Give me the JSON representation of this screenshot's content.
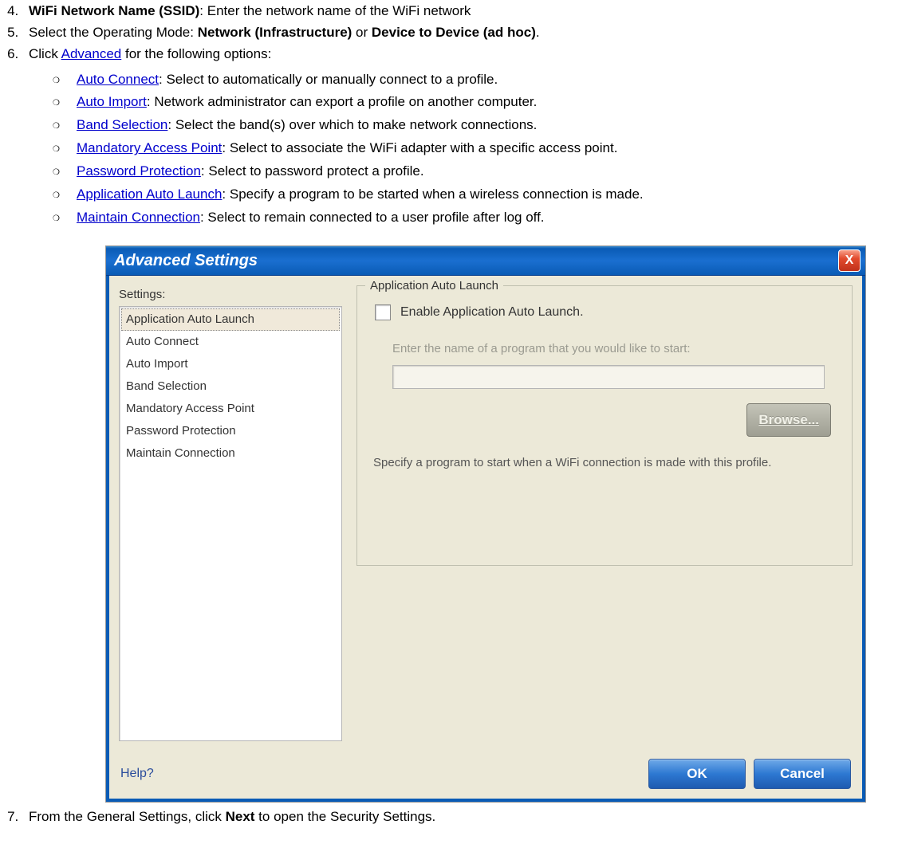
{
  "instructions": {
    "item4": {
      "bold": "WiFi Network Name (SSID)",
      "rest": ": Enter the network name of the WiFi network"
    },
    "item5": {
      "pre": "Select the Operating Mode: ",
      "b1": "Network (Infrastructure)",
      "mid": " or ",
      "b2": "Device to Device (ad hoc)",
      "post": "."
    },
    "item6": {
      "pre": "Click ",
      "link": "Advanced",
      "post": " for the following options:",
      "sub": [
        {
          "link": "Auto Connect",
          "rest": ": Select to automatically or manually connect to a profile."
        },
        {
          "link": "Auto Import",
          "rest": ": Network administrator can export a profile on another computer."
        },
        {
          "link": "Band Selection",
          "rest": ": Select the band(s) over which to make network connections."
        },
        {
          "link": "Mandatory Access Point",
          "rest": ": Select to associate the WiFi adapter with a specific access point."
        },
        {
          "link": "Password Protection",
          "rest": ": Select to password protect a profile."
        },
        {
          "link": "Application Auto Launch",
          "rest": ": Specify a program to be started when a wireless connection is made."
        },
        {
          "link": "Maintain Connection",
          "rest": ": Select to remain connected to a user profile after log off."
        }
      ]
    },
    "item7": {
      "pre": "From the General Settings, click ",
      "b1": "Next",
      "post": " to open the Security Settings."
    }
  },
  "dialog": {
    "title": "Advanced Settings",
    "close": "X",
    "settings_label": "Settings:",
    "settings_items": [
      "Application Auto Launch",
      "Auto Connect",
      "Auto Import",
      "Band Selection",
      "Mandatory Access Point",
      "Password Protection",
      "Maintain Connection"
    ],
    "group_title": "Application Auto Launch",
    "checkbox_label": "Enable Application Auto Launch.",
    "disabled_prompt": "Enter the name of a program that you would like to start:",
    "browse_label": "Browse...",
    "description": "Specify a program to start when a WiFi connection is made with this profile.",
    "help": "Help?",
    "ok": "OK",
    "cancel": "Cancel"
  }
}
